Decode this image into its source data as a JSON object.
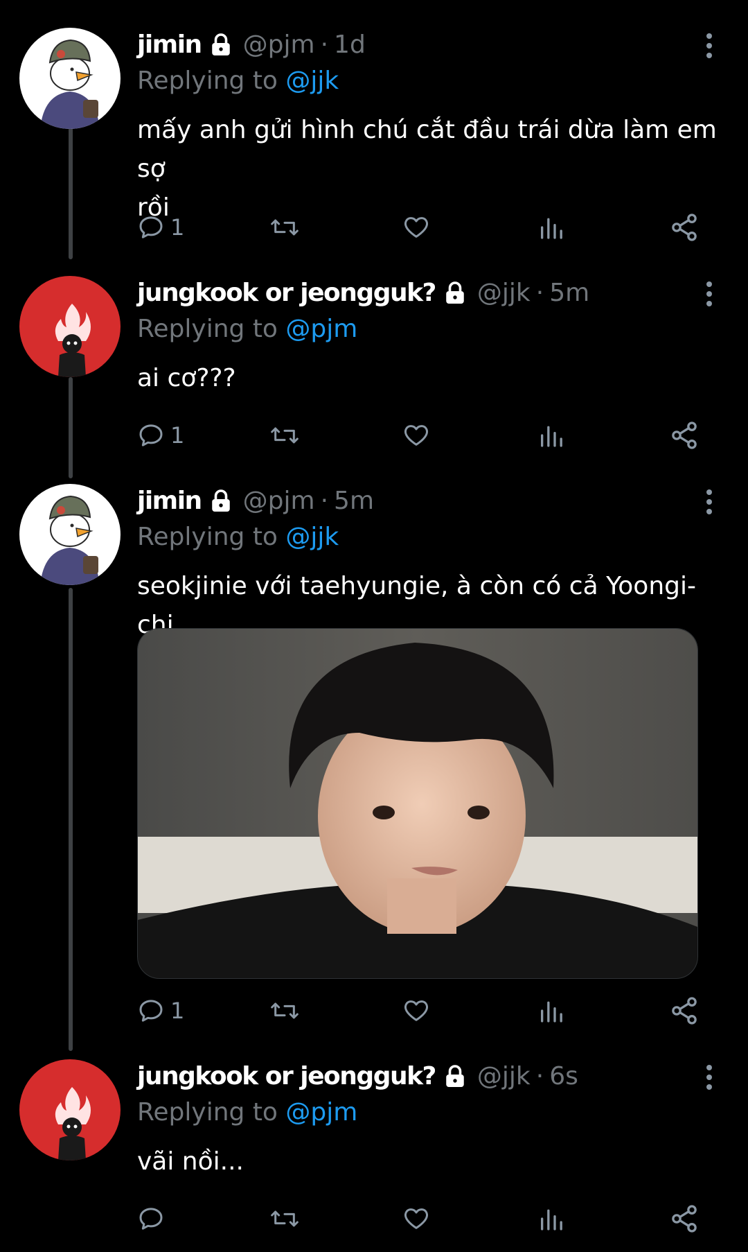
{
  "thread": [
    {
      "author": "jimin",
      "handle": "@pjm",
      "separator": "·",
      "time": "1d",
      "reply_prefix": "Replying to ",
      "reply_to": "@jjk",
      "text": "mấy anh gửi hình chú cắt đầu trái dừa làm em sợ\nrồi",
      "reply_count": "1",
      "avatar": "duck-avatar"
    },
    {
      "author": "jungkook or jeongguk?",
      "handle": "@jjk",
      "separator": "·",
      "time": "5m",
      "reply_prefix": "Replying to ",
      "reply_to": "@pjm",
      "text": "ai cơ???",
      "reply_count": "1",
      "avatar": "flame-avatar"
    },
    {
      "author": "jimin",
      "handle": "@pjm",
      "separator": "·",
      "time": "5m",
      "reply_prefix": "Replying to ",
      "reply_to": "@jjk",
      "text": "seokjinie với taehyungie, à còn có cả Yoongi-chi",
      "reply_count": "1",
      "avatar": "duck-avatar",
      "has_media": true
    },
    {
      "author": "jungkook or jeongguk?",
      "handle": "@jjk",
      "separator": "·",
      "time": "6s",
      "reply_prefix": "Replying to ",
      "reply_to": "@pjm",
      "text": "vãi nồi...",
      "reply_count": "",
      "avatar": "flame-avatar"
    }
  ],
  "icons": {
    "protected": "lock-icon",
    "more": "more-vertical-icon",
    "reply": "reply-icon",
    "retweet": "retweet-icon",
    "like": "heart-icon",
    "views": "analytics-icon",
    "share": "share-icon"
  },
  "colors": {
    "background": "#000000",
    "primary_text": "#ffffff",
    "secondary_text": "#71767b",
    "link": "#1d9bf0",
    "thread_line": "#3e4144",
    "avatar_red": "#d62d2d"
  }
}
